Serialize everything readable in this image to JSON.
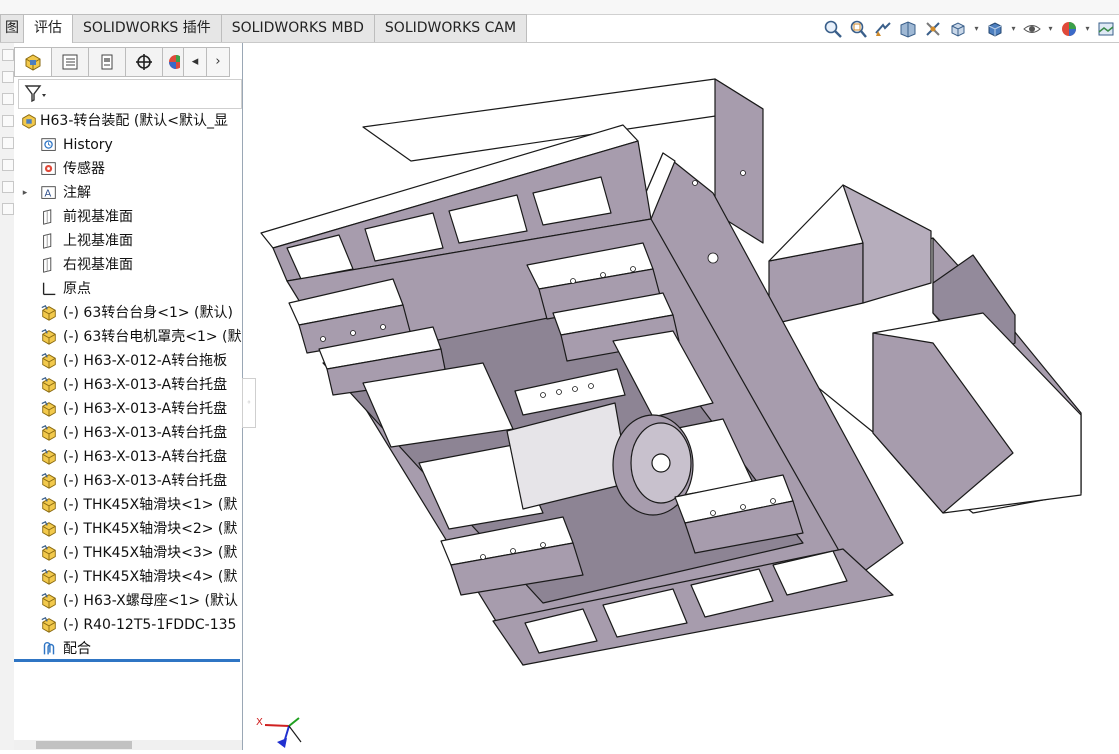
{
  "app": {
    "name": "SOLIDWORKS"
  },
  "tabs": [
    {
      "label": "图",
      "active": false
    },
    {
      "label": "评估",
      "active": true
    },
    {
      "label": "SOLIDWORKS 插件",
      "active": false
    },
    {
      "label": "SOLIDWORKS MBD",
      "active": false
    },
    {
      "label": "SOLIDWORKS CAM",
      "active": false
    }
  ],
  "view_toolbar": [
    "zoom-to-fit-icon",
    "zoom-to-area-icon",
    "previous-view-icon",
    "section-view-icon",
    "dynamic-annotation-icon",
    "view-orientation-icon",
    "display-style-icon",
    "hide-show-icon",
    "edit-appearance-icon",
    "apply-scene-icon"
  ],
  "panel_tabs": [
    "feature-manager-tab",
    "property-manager-tab",
    "configuration-manager-tab",
    "dimxpert-manager-tab",
    "display-manager-tab"
  ],
  "tree": {
    "root": "H63-转台装配  (默认<默认_显",
    "items": [
      {
        "label": "History",
        "icon": "history-icon",
        "indent": 1,
        "expand": false
      },
      {
        "label": "传感器",
        "icon": "sensor-icon",
        "indent": 1,
        "expand": false
      },
      {
        "label": "注解",
        "icon": "annotation-icon",
        "indent": 1,
        "expand": true
      },
      {
        "label": "前视基准面",
        "icon": "plane-icon",
        "indent": 1,
        "expand": false
      },
      {
        "label": "上视基准面",
        "icon": "plane-icon",
        "indent": 1,
        "expand": false
      },
      {
        "label": "右视基准面",
        "icon": "plane-icon",
        "indent": 1,
        "expand": false
      },
      {
        "label": "原点",
        "icon": "origin-icon",
        "indent": 1,
        "expand": false
      },
      {
        "label": "(-) 63转台台身<1> (默认)",
        "icon": "part-icon",
        "indent": 1,
        "expand": false
      },
      {
        "label": "(-) 63转台电机罩壳<1> (默",
        "icon": "part-icon",
        "indent": 1,
        "expand": false
      },
      {
        "label": "(-) H63-X-012-A转台拖板",
        "icon": "part-icon",
        "indent": 1,
        "expand": false
      },
      {
        "label": "(-) H63-X-013-A转台托盘",
        "icon": "part-icon",
        "indent": 1,
        "expand": false
      },
      {
        "label": "(-) H63-X-013-A转台托盘",
        "icon": "part-icon",
        "indent": 1,
        "expand": false
      },
      {
        "label": "(-) H63-X-013-A转台托盘",
        "icon": "part-icon",
        "indent": 1,
        "expand": false
      },
      {
        "label": "(-) H63-X-013-A转台托盘",
        "icon": "part-icon",
        "indent": 1,
        "expand": false
      },
      {
        "label": "(-) H63-X-013-A转台托盘",
        "icon": "part-icon",
        "indent": 1,
        "expand": false
      },
      {
        "label": "(-) THK45X轴滑块<1> (默",
        "icon": "part-icon",
        "indent": 1,
        "expand": false
      },
      {
        "label": "(-) THK45X轴滑块<2> (默",
        "icon": "part-icon",
        "indent": 1,
        "expand": false
      },
      {
        "label": "(-) THK45X轴滑块<3> (默",
        "icon": "part-icon",
        "indent": 1,
        "expand": false
      },
      {
        "label": "(-) THK45X轴滑块<4> (默",
        "icon": "part-icon",
        "indent": 1,
        "expand": false
      },
      {
        "label": "(-) H63-X螺母座<1> (默认",
        "icon": "part-icon",
        "indent": 1,
        "expand": false
      },
      {
        "label": "(-) R40-12T5-1FDDC-135",
        "icon": "part-icon",
        "indent": 1,
        "expand": false
      },
      {
        "label": "配合",
        "icon": "mates-icon",
        "indent": 1,
        "expand": false
      }
    ]
  },
  "triad": {
    "x_label": "X"
  },
  "colors": {
    "model_face": "#a79cad",
    "model_light": "#ffffff",
    "model_dark": "#5f5862",
    "accent": "#2f75c4"
  }
}
